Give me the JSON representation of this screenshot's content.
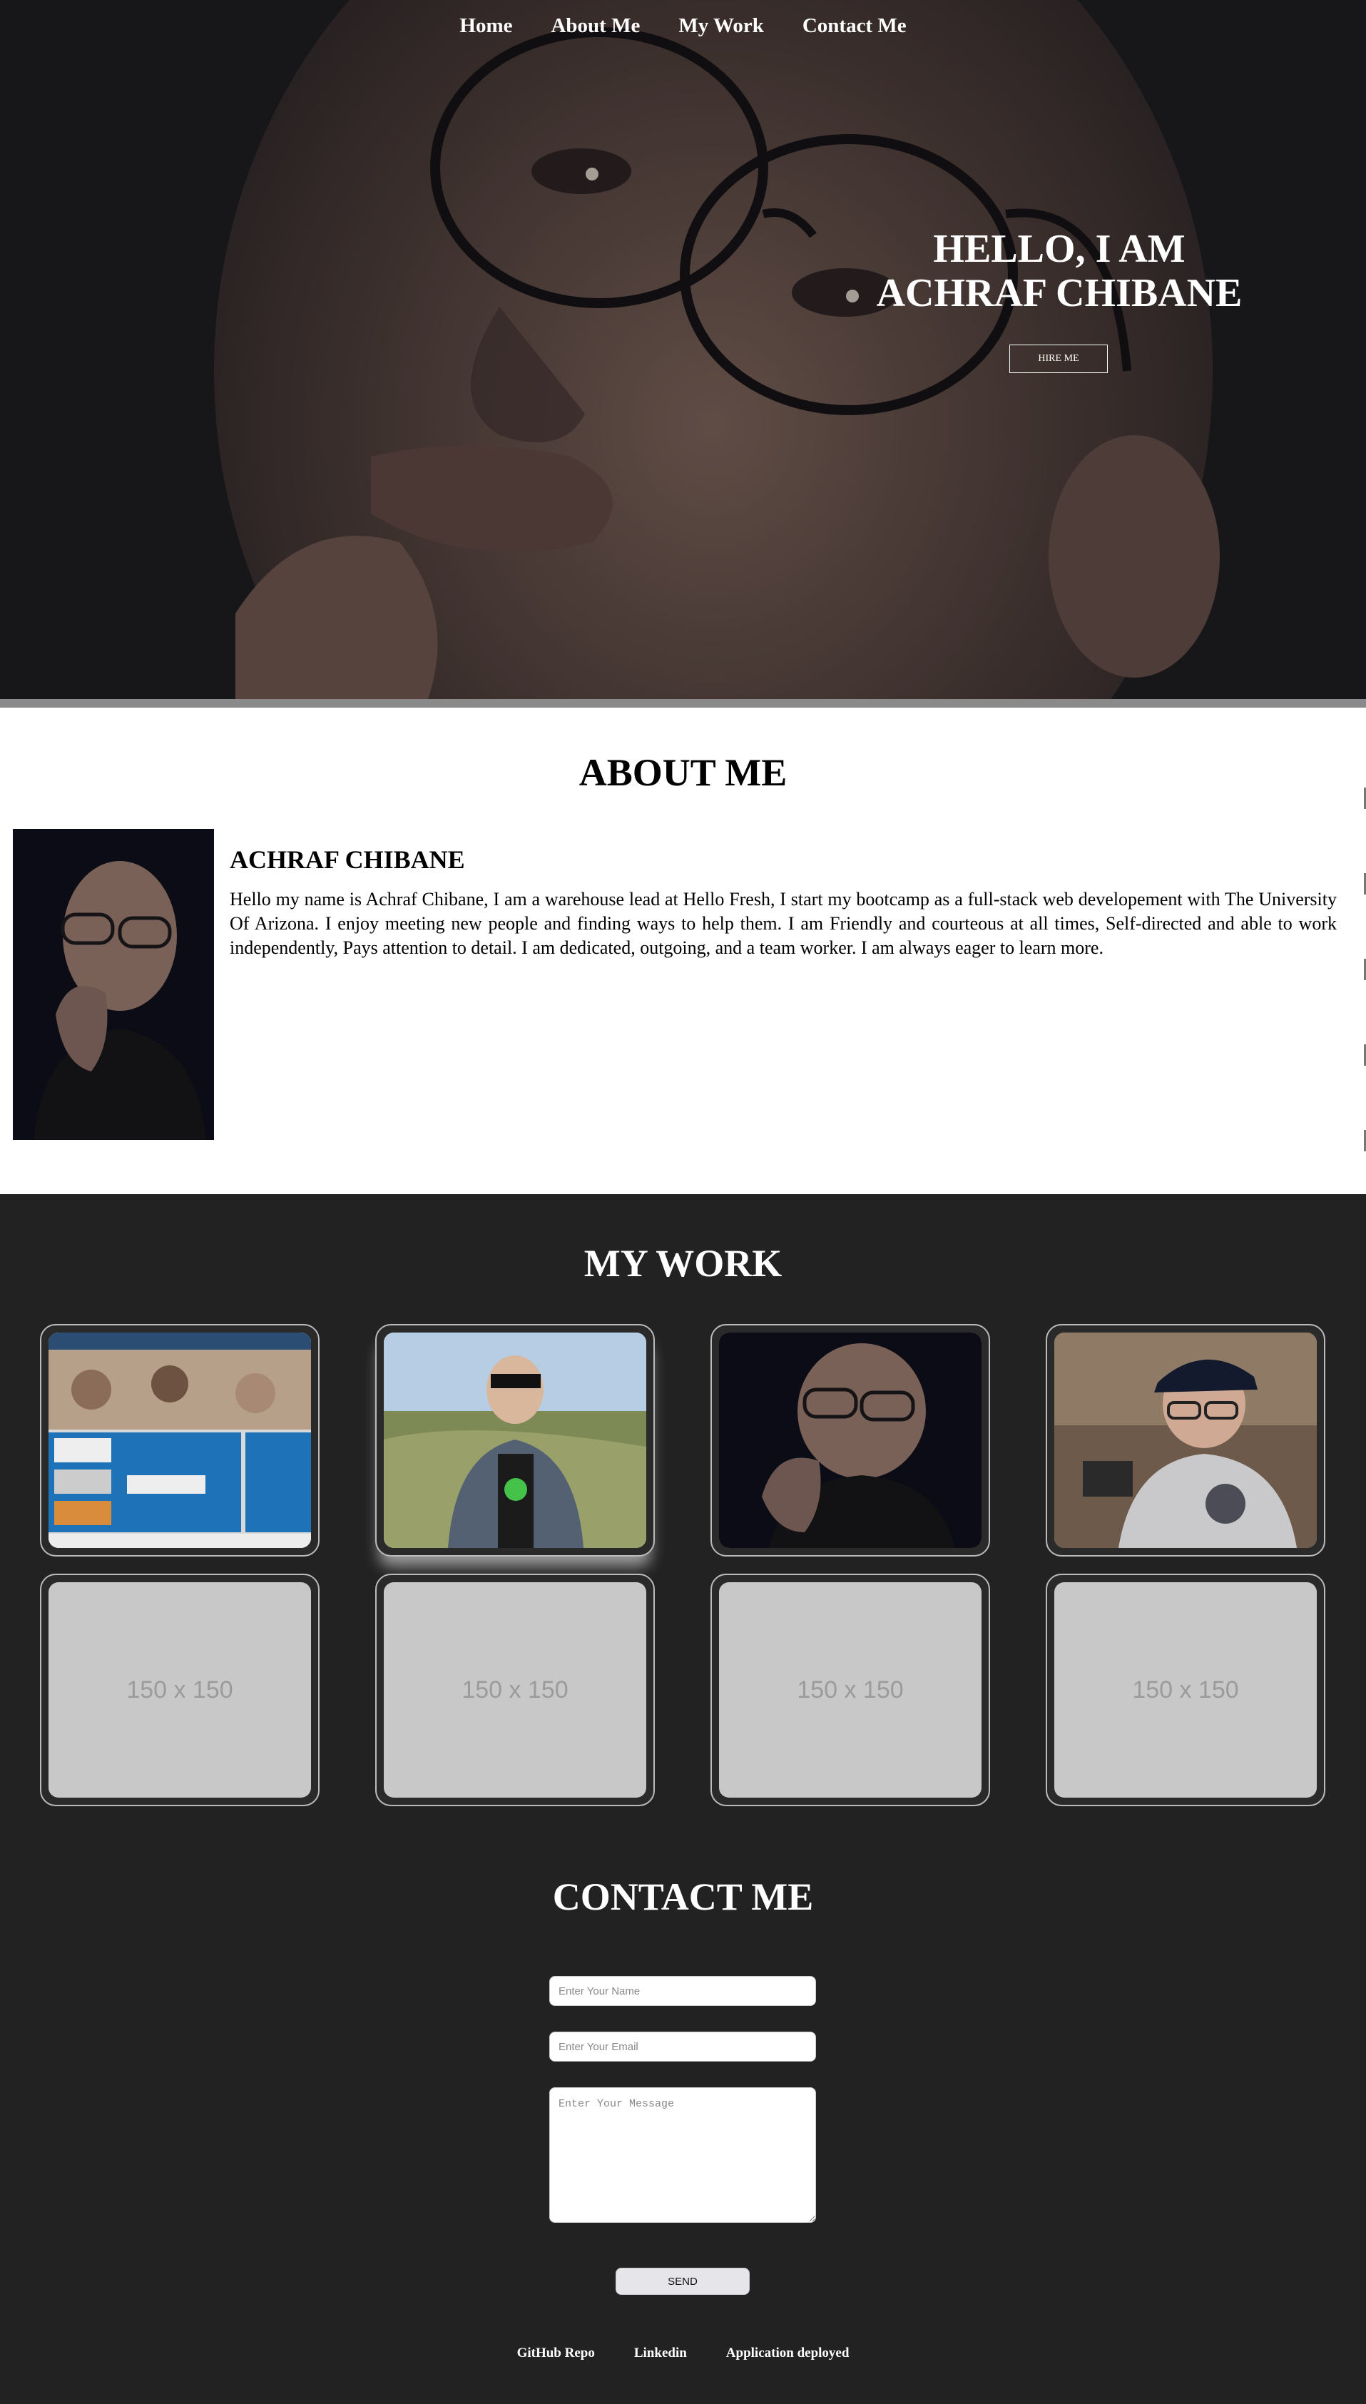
{
  "nav": {
    "items": [
      "Home",
      "About Me",
      "My Work",
      "Contact Me"
    ]
  },
  "hero": {
    "title_line1": "HELLO, I AM",
    "title_line2": "ACHRAF CHIBANE",
    "hire_label": "HIRE ME"
  },
  "about": {
    "heading": "ABOUT ME",
    "name": "ACHRAF CHIBANE",
    "bio": "Hello my name is Achraf Chibane, I am a warehouse lead at Hello Fresh, I start my bootcamp as a full-stack web developement with The University Of Arizona. I enjoy meeting new people and finding ways to help them. I am Friendly and courteous at all times, Self-directed and able to work independently, Pays attention to detail. I am dedicated, outgoing, and a team worker. I am always eager to learn more."
  },
  "work": {
    "heading": "MY WORK",
    "placeholder_label": "150 x 150"
  },
  "contact": {
    "heading": "CONTACT ME",
    "name_placeholder": "Enter Your Name",
    "email_placeholder": "Enter Your Email",
    "message_placeholder": "Enter Your Message",
    "send_label": "SEND"
  },
  "footer": {
    "links": [
      "GitHub Repo",
      "Linkedin",
      "Application deployed"
    ]
  },
  "colors": {
    "page_background": "#222222",
    "about_background": "#ffffff",
    "text_light": "#ffffff",
    "text_dark": "#000000"
  }
}
